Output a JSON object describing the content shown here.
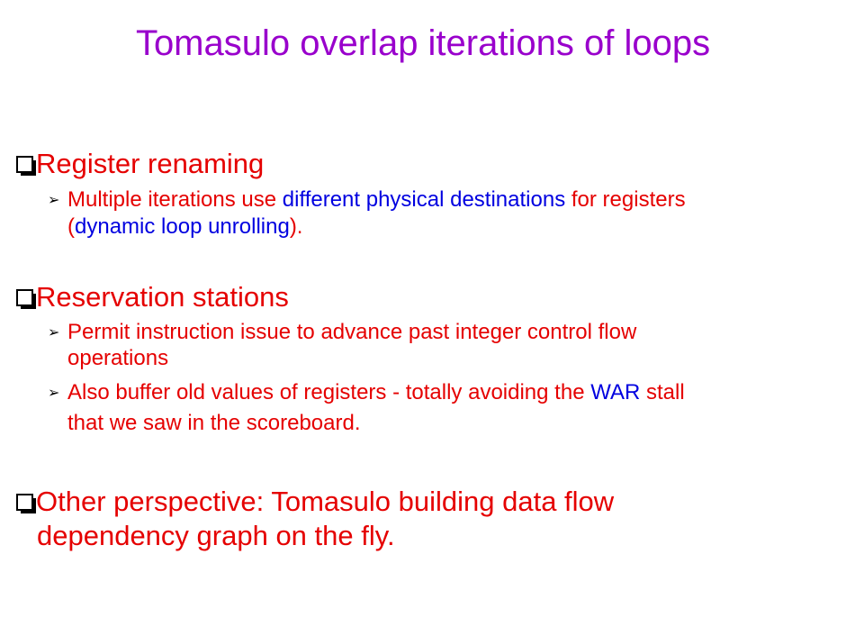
{
  "slide": {
    "title": "Tomasulo overlap iterations of loops"
  },
  "colors": {
    "title": "#9900cc",
    "red": "#e50000",
    "blue": "#0000e0",
    "bullet": "#000000"
  },
  "icons": {
    "l1_bullet": "hollow-square-bullet-icon",
    "l2_bullet": "arrowhead-bullet-icon"
  },
  "bullets": {
    "renaming": {
      "label": "Register renaming",
      "sub": {
        "arrow": "➢",
        "part1": "Multiple iterations use ",
        "part2": "different physical destinations",
        "part3": " for registers",
        "part4": "(",
        "part5": "dynamic loop unrolling",
        "part6": ")."
      }
    },
    "stations": {
      "label": "Reservation stations",
      "sub1": {
        "arrow": "➢",
        "line1": "Permit instruction issue to advance past integer control flow",
        "line2": "operations"
      },
      "sub2": {
        "arrow": "➢",
        "part1": "Also buffer old values of registers - totally avoiding the ",
        "part2": "WAR",
        "part3": " stall",
        "line2": "that we saw in the scoreboard."
      }
    },
    "perspective": {
      "line1": "Other perspective: Tomasulo building data flow",
      "line2": "dependency graph on the fly."
    }
  }
}
